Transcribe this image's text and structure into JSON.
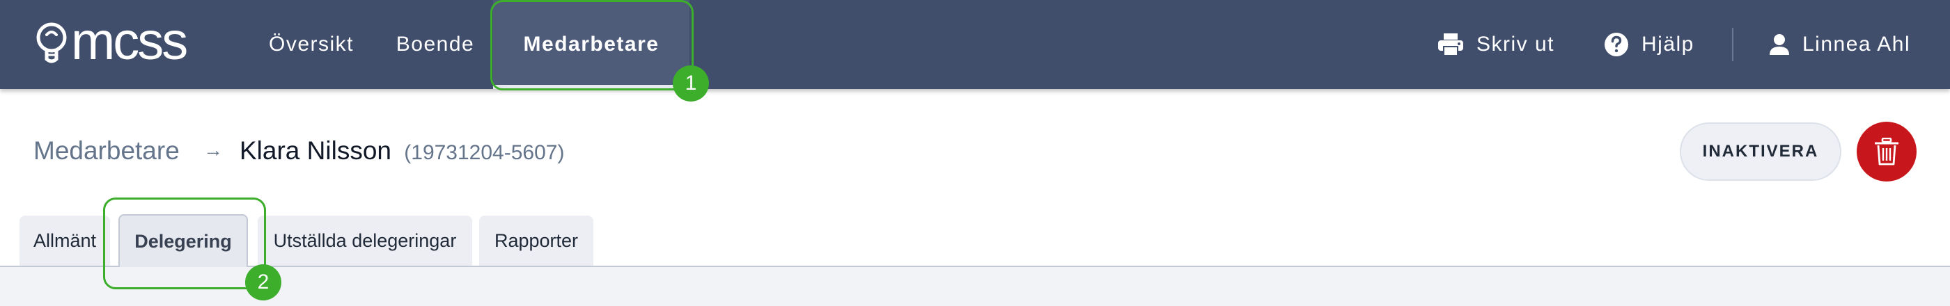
{
  "brand": {
    "logo_text": "mcss"
  },
  "nav": {
    "items": [
      {
        "label": "Översikt"
      },
      {
        "label": "Boende"
      },
      {
        "label": "Medarbetare"
      }
    ],
    "print_label": "Skriv ut",
    "help_label": "Hjälp",
    "user_label": "Linnea Ahl"
  },
  "breadcrumb": {
    "root": "Medarbetare",
    "arrow": "→",
    "current_name": "Klara Nilsson",
    "current_id": "(19731204-5607)"
  },
  "actions": {
    "inactivate_label": "INAKTIVERA"
  },
  "tabs": [
    {
      "label": "Allmänt"
    },
    {
      "label": "Delegering"
    },
    {
      "label": "Utställda delegeringar"
    },
    {
      "label": "Rapporter"
    }
  ],
  "callouts": [
    {
      "number": "1"
    },
    {
      "number": "2"
    }
  ],
  "colors": {
    "topbar": "#404e6c",
    "highlight": "#3dae2b",
    "delete": "#c8171c"
  }
}
